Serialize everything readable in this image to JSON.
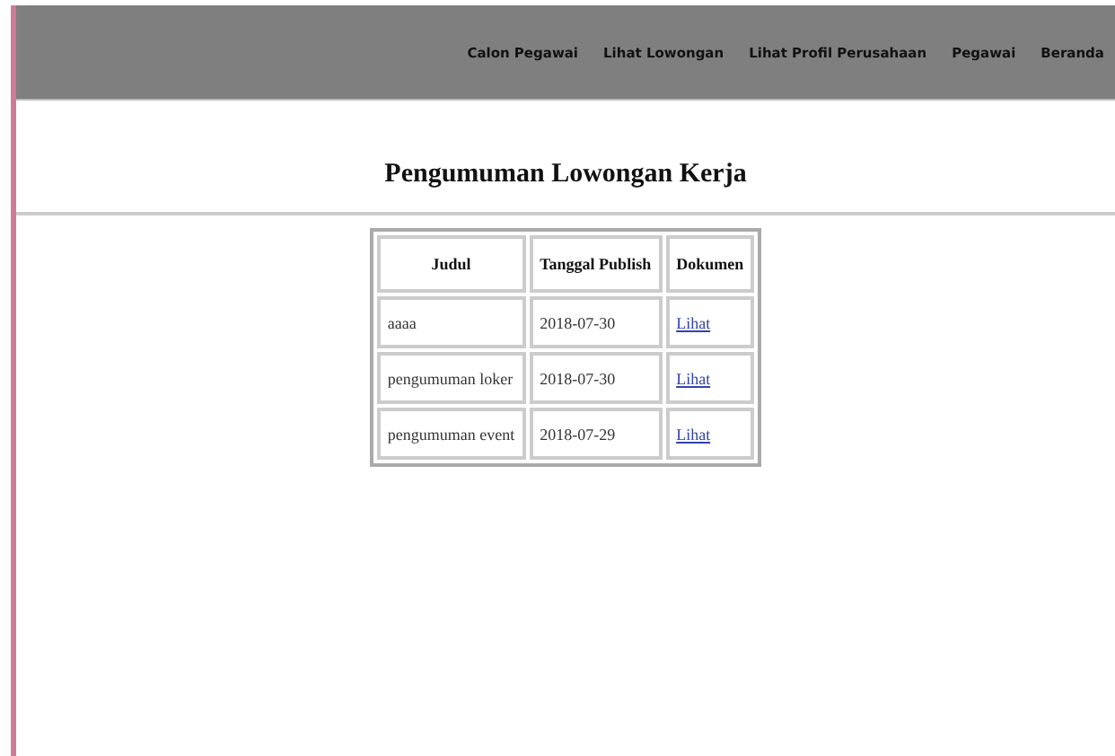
{
  "nav": {
    "items": [
      "Calon Pegawai",
      "Lihat Lowongan",
      "Lihat Profil Perusahaan",
      "Pegawai",
      "Beranda"
    ]
  },
  "heading": "Pengumuman Lowongan Kerja",
  "table": {
    "columns": [
      "Judul",
      "Tanggal Publish",
      "Dokumen"
    ],
    "rows": [
      {
        "judul": "aaaa",
        "tanggal": "2018-07-30",
        "dokumen": "Lihat"
      },
      {
        "judul": "pengumuman loker",
        "tanggal": "2018-07-30",
        "dokumen": "Lihat"
      },
      {
        "judul": "pengumuman event",
        "tanggal": "2018-07-29",
        "dokumen": "Lihat"
      }
    ]
  }
}
